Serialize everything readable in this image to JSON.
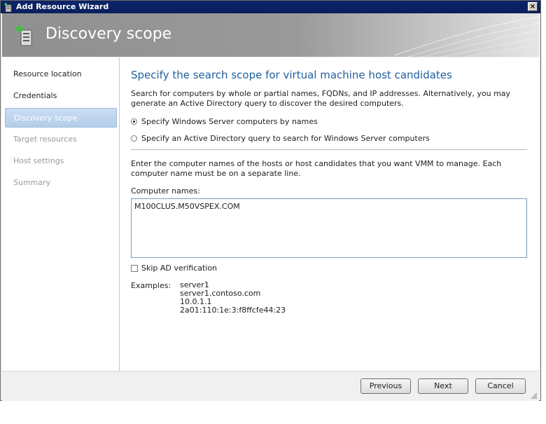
{
  "window": {
    "title": "Add Resource Wizard",
    "close_glyph": "×"
  },
  "banner": {
    "title": "Discovery scope",
    "icon": "add-server-icon"
  },
  "sidebar": {
    "items": [
      {
        "label": "Resource location",
        "state": "completed"
      },
      {
        "label": "Credentials",
        "state": "completed"
      },
      {
        "label": "Discovery scope",
        "state": "active"
      },
      {
        "label": "Target resources",
        "state": "pending"
      },
      {
        "label": "Host settings",
        "state": "pending"
      },
      {
        "label": "Summary",
        "state": "pending"
      }
    ]
  },
  "main": {
    "heading": "Specify the search scope for virtual machine host candidates",
    "description": "Search for computers by whole or partial names, FQDNs, and IP addresses. Alternatively, you may generate an Active Directory query to discover the desired computers.",
    "radio_names": {
      "label": "Specify Windows Server computers by names",
      "checked": true
    },
    "radio_ad": {
      "label": "Specify an Active Directory query to search for Windows Server computers",
      "checked": false
    },
    "instructions": "Enter the computer names of the hosts or host candidates that you want VMM to manage. Each computer name must be on a separate line.",
    "computer_names_label": "Computer names:",
    "computer_names_value": "M100CLUS.M50VSPEX.COM",
    "skip_ad": {
      "label": "Skip AD verification",
      "checked": false
    },
    "examples_label": "Examples:",
    "examples": [
      "server1",
      "server1.contoso.com",
      "10.0.1.1",
      "2a01:110:1e:3:f8ffcfe44:23"
    ]
  },
  "footer": {
    "previous": "Previous",
    "next": "Next",
    "cancel": "Cancel"
  },
  "colors": {
    "title_bar": "#0b246a",
    "heading": "#1f5f9e",
    "active_nav": "#c9ddf4"
  }
}
